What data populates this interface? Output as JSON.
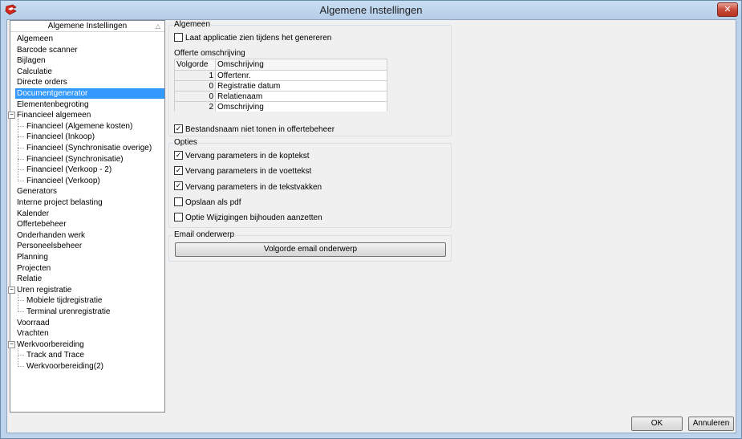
{
  "window": {
    "title": "Algemene Instellingen",
    "close_icon": "close-icon",
    "app_icon": "app-logo-icon"
  },
  "tree": {
    "header": "Algemene Instellingen",
    "sort_glyph": "△",
    "items": [
      {
        "label": "Algemeen",
        "level": 0
      },
      {
        "label": "Barcode scanner",
        "level": 0
      },
      {
        "label": "Bijlagen",
        "level": 0
      },
      {
        "label": "Calculatie",
        "level": 0
      },
      {
        "label": "Directe orders",
        "level": 0
      },
      {
        "label": "Documentgenerator",
        "level": 0,
        "selected": true
      },
      {
        "label": "Elementenbegroting",
        "level": 0
      },
      {
        "label": "Financieel algemeen",
        "level": 0,
        "expander": "⊟"
      },
      {
        "label": "Financieel (Algemene kosten)",
        "level": 1
      },
      {
        "label": "Financieel (Inkoop)",
        "level": 1
      },
      {
        "label": "Financieel (Synchronisatie overige)",
        "level": 1
      },
      {
        "label": "Financieel (Synchronisatie)",
        "level": 1
      },
      {
        "label": "Financieel (Verkoop - 2)",
        "level": 1
      },
      {
        "label": "Financieel (Verkoop)",
        "level": 1
      },
      {
        "label": "Generators",
        "level": 0
      },
      {
        "label": "Interne project belasting",
        "level": 0
      },
      {
        "label": "Kalender",
        "level": 0
      },
      {
        "label": "Offertebeheer",
        "level": 0
      },
      {
        "label": "Onderhanden werk",
        "level": 0
      },
      {
        "label": "Personeelsbeheer",
        "level": 0
      },
      {
        "label": "Planning",
        "level": 0
      },
      {
        "label": "Projecten",
        "level": 0
      },
      {
        "label": "Relatie",
        "level": 0
      },
      {
        "label": "Uren registratie",
        "level": 0,
        "expander": "⊟"
      },
      {
        "label": "Mobiele tijdregistratie",
        "level": 1
      },
      {
        "label": "Terminal urenregistratie",
        "level": 1
      },
      {
        "label": "Voorraad",
        "level": 0
      },
      {
        "label": "Vrachten",
        "level": 0
      },
      {
        "label": "Werkvoorbereiding",
        "level": 0,
        "expander": "⊟"
      },
      {
        "label": "Track and Trace",
        "level": 1
      },
      {
        "label": "Werkvoorbereiding(2)",
        "level": 1
      }
    ]
  },
  "algemeen": {
    "title": "Algemeen",
    "show_app_label": "Laat applicatie zien tijdens het genereren",
    "show_app_checked": false,
    "offerte_label": "Offerte omschrijving",
    "grid_headers": [
      "Volgorde",
      "Omschrijving"
    ],
    "grid_rows": [
      {
        "volgorde": "1",
        "omschrijving": "Offertenr."
      },
      {
        "volgorde": "0",
        "omschrijving": "Registratie datum"
      },
      {
        "volgorde": "0",
        "omschrijving": "Relatienaam"
      },
      {
        "volgorde": "2",
        "omschrijving": "Omschrijving"
      }
    ],
    "hide_filename_label": "Bestandsnaam niet tonen in offertebeheer",
    "hide_filename_checked": true
  },
  "opties": {
    "title": "Opties",
    "items": [
      {
        "label": "Vervang parameters in de koptekst",
        "checked": true
      },
      {
        "label": "Vervang parameters in de voettekst",
        "checked": true
      },
      {
        "label": "Vervang parameters in de tekstvakken",
        "checked": true
      },
      {
        "label": "Opslaan als pdf",
        "checked": false
      },
      {
        "label": "Optie Wijzigingen bijhouden aanzetten",
        "checked": false
      }
    ]
  },
  "email": {
    "title": "Email onderwerp",
    "button": "Volgorde email onderwerp"
  },
  "footer": {
    "ok": "OK",
    "cancel": "Annuleren"
  },
  "check_glyph": "✓"
}
